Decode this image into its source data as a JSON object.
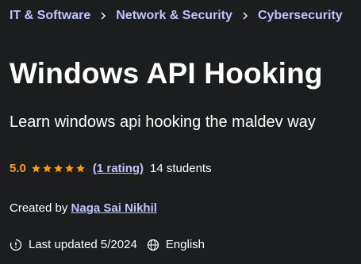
{
  "breadcrumb": {
    "items": [
      {
        "label": "IT & Software"
      },
      {
        "label": "Network & Security"
      },
      {
        "label": "Cybersecurity"
      }
    ],
    "separator_icon": "chevron-right-icon"
  },
  "course": {
    "title": "Windows API Hooking",
    "subtitle": "Learn windows api hooking the maldev way",
    "rating_value": "5.0",
    "stars": 5,
    "rating_count_label": "(1 rating)",
    "students_label": "14 students",
    "created_by_label": "Created by",
    "author": "Naga Sai Nikhil",
    "last_updated_label": "Last updated 5/2024",
    "language": "English"
  },
  "colors": {
    "background": "#1c1d1f",
    "link": "#c0c4fc",
    "star": "#f69c08",
    "text": "#ffffff"
  },
  "icons": {
    "updated": "alert-clock-icon",
    "language": "globe-icon"
  }
}
